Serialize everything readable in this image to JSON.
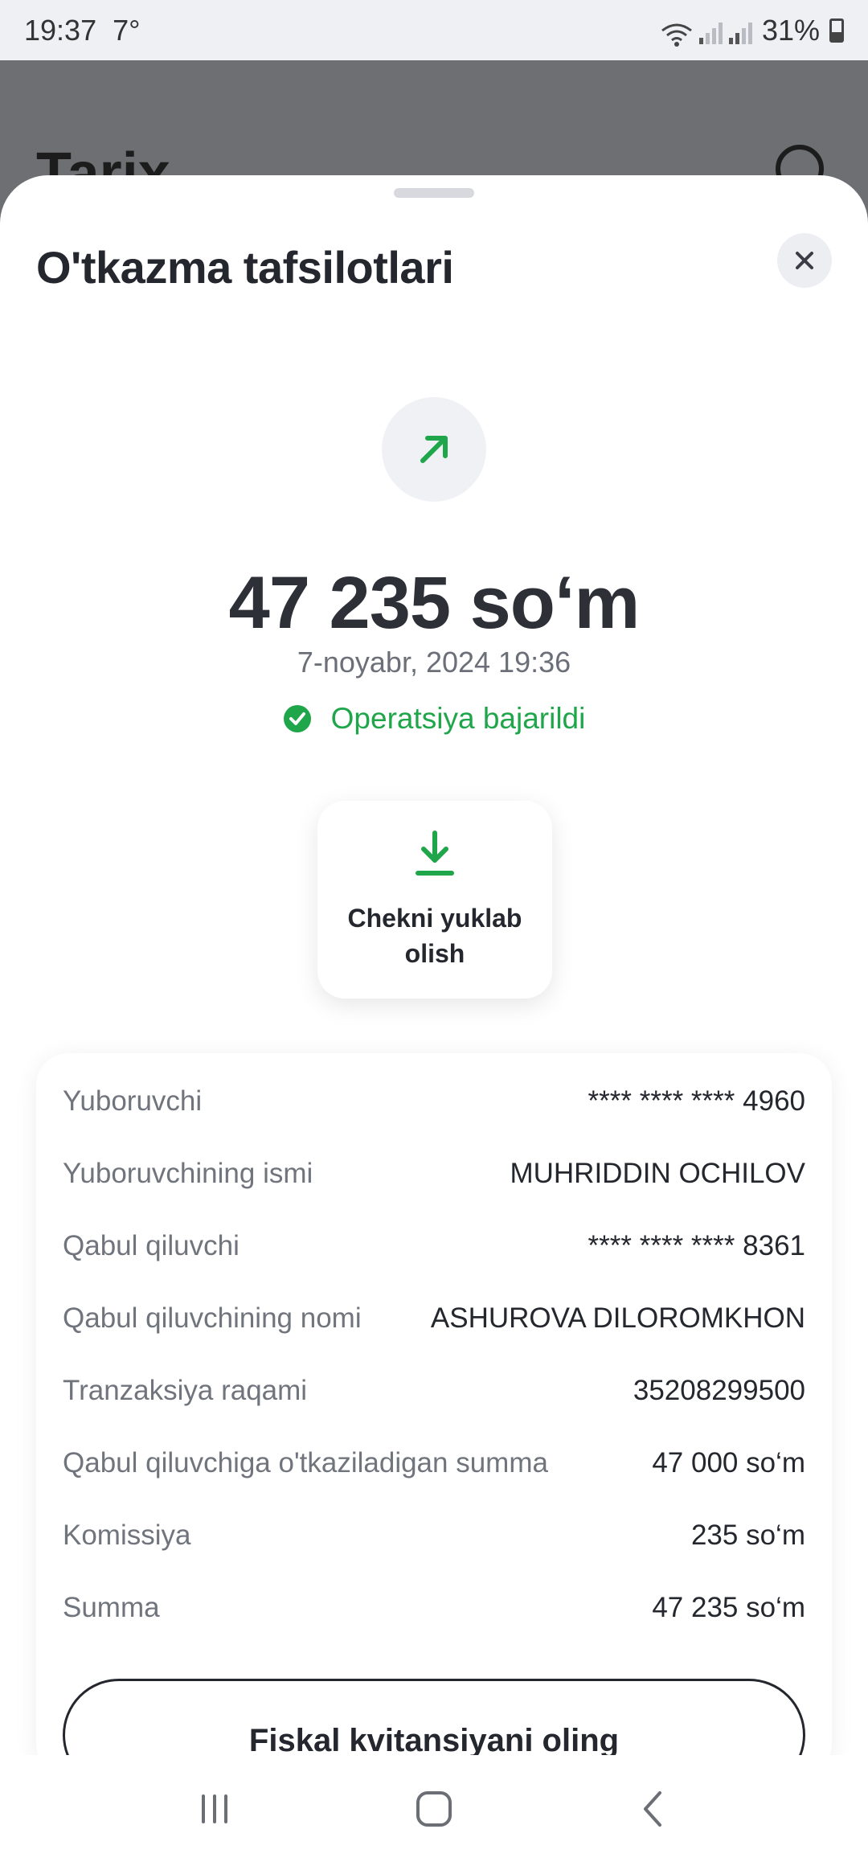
{
  "status_bar": {
    "time": "19:37",
    "temperature": "7°",
    "battery": "31%"
  },
  "background_screen": {
    "title": "Tarix"
  },
  "sheet": {
    "title": "O'tkazma tafsilotlari",
    "direction_icon": "arrow-up-right-icon",
    "amount": "47 235 so‘m",
    "datetime": "7-noyabr, 2024 19:36",
    "status_text": "Operatsiya bajarildi",
    "status_color": "#1fa64a",
    "download_receipt_label": "Chekni yuklab olish",
    "details": [
      {
        "label": "Yuboruvchi",
        "value": "**** **** **** 4960"
      },
      {
        "label": "Yuboruvchining ismi",
        "value": "MUHRIDDIN OCHILOV"
      },
      {
        "label": "Qabul qiluvchi",
        "value": "**** **** **** 8361"
      },
      {
        "label": "Qabul qiluvchining nomi",
        "value": "ASHUROVA DILOROMKHON"
      },
      {
        "label": "Tranzaksiya raqami",
        "value": "35208299500"
      },
      {
        "label": "Qabul qiluvchiga o'tkaziladigan summa",
        "value": "47 000 so‘m"
      },
      {
        "label": "Komissiya",
        "value": "235 so‘m"
      },
      {
        "label": "Summa",
        "value": "47 235 so‘m"
      }
    ],
    "fiscal_button_label": "Fiskal kvitansiyani oling"
  },
  "nav_bar": {
    "recents_icon": "recents-icon",
    "home_icon": "home-icon",
    "back_icon": "back-icon"
  }
}
